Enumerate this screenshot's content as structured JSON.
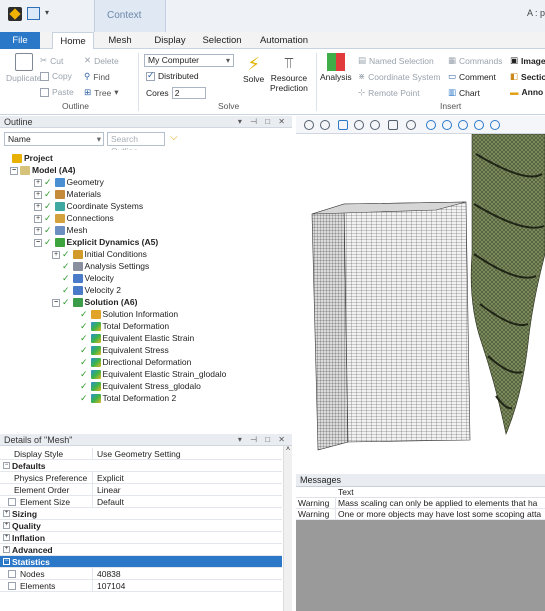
{
  "titlebar": {
    "context_label": "Context",
    "app_title": "A : p"
  },
  "tabs": [
    {
      "label": "File"
    },
    {
      "label": "Home"
    },
    {
      "label": "Mesh"
    },
    {
      "label": "Display"
    },
    {
      "label": "Selection"
    },
    {
      "label": "Automation"
    }
  ],
  "ribbon": {
    "outline_group": {
      "label": "Outline",
      "duplicate": "Duplicate",
      "cut": "Cut",
      "copy": "Copy",
      "paste": "Paste",
      "delete": "Delete",
      "find": "Find",
      "tree": "Tree"
    },
    "solve_group": {
      "label": "Solve",
      "computer_select": "My Computer",
      "distributed_label": "Distributed",
      "distributed_checked": true,
      "cores_label": "Cores",
      "cores_value": "2",
      "solve": "Solve",
      "resource_prediction_1": "Resource",
      "resource_prediction_2": "Prediction"
    },
    "insert_group": {
      "label": "Insert",
      "analysis": "Analysis",
      "named_selection": "Named Selection",
      "coordinate_system": "Coordinate System",
      "remote_point": "Remote Point",
      "commands": "Commands",
      "comment": "Comment",
      "chart": "Chart",
      "images": "Image",
      "section": "Sectio",
      "annotation": "Anno"
    }
  },
  "outline": {
    "title": "Outline",
    "name_filter": "Name",
    "search_placeholder": "Search Outline",
    "tree": [
      {
        "label": "Project",
        "level": 0
      },
      {
        "label": "Model (A4)",
        "level": 1
      },
      {
        "label": "Geometry",
        "level": 2
      },
      {
        "label": "Materials",
        "level": 2
      },
      {
        "label": "Coordinate Systems",
        "level": 2
      },
      {
        "label": "Connections",
        "level": 2
      },
      {
        "label": "Mesh",
        "level": 2
      },
      {
        "label": "Explicit Dynamics (A5)",
        "level": 2
      },
      {
        "label": "Initial Conditions",
        "level": 3
      },
      {
        "label": "Analysis Settings",
        "level": 3
      },
      {
        "label": "Velocity",
        "level": 3
      },
      {
        "label": "Velocity 2",
        "level": 3
      },
      {
        "label": "Solution (A6)",
        "level": 3
      },
      {
        "label": "Solution Information",
        "level": 4
      },
      {
        "label": "Total Deformation",
        "level": 4
      },
      {
        "label": "Equivalent Elastic Strain",
        "level": 4
      },
      {
        "label": "Equivalent Stress",
        "level": 4
      },
      {
        "label": "Directional Deformation",
        "level": 4
      },
      {
        "label": "Equivalent Elastic Strain_glodalo",
        "level": 4
      },
      {
        "label": "Equivalent Stress_glodalo",
        "level": 4
      },
      {
        "label": "Total Deformation 2",
        "level": 4
      }
    ]
  },
  "details": {
    "title": "Details of \"Mesh\"",
    "rows": [
      {
        "key": "Display Style",
        "value": "Use Geometry Setting"
      },
      {
        "key": "Defaults",
        "section": true
      },
      {
        "key": "Physics Preference",
        "value": "Explicit"
      },
      {
        "key": "Element Order",
        "value": "Linear"
      },
      {
        "key": "Element Size",
        "value": "Default"
      },
      {
        "key": "Sizing",
        "section": true
      },
      {
        "key": "Quality",
        "section": true
      },
      {
        "key": "Inflation",
        "section": true
      },
      {
        "key": "Advanced",
        "section": true
      },
      {
        "key": "Statistics",
        "section": true
      },
      {
        "key": "Nodes",
        "value": "40838"
      },
      {
        "key": "Elements",
        "value": "107104"
      }
    ]
  },
  "messages": {
    "title": "Messages",
    "col_text": "Text",
    "rows": [
      {
        "type": "Warning",
        "text": "Mass scaling can only be applied to elements that ha"
      },
      {
        "type": "Warning",
        "text": "One or more objects may have lost some scoping atta"
      }
    ]
  },
  "colors": {
    "accent": "#2b78c8",
    "ribbon_bg": "#ffffff",
    "mesh_line": "#3a3a3a",
    "tool_fill": "#6f7e55"
  }
}
